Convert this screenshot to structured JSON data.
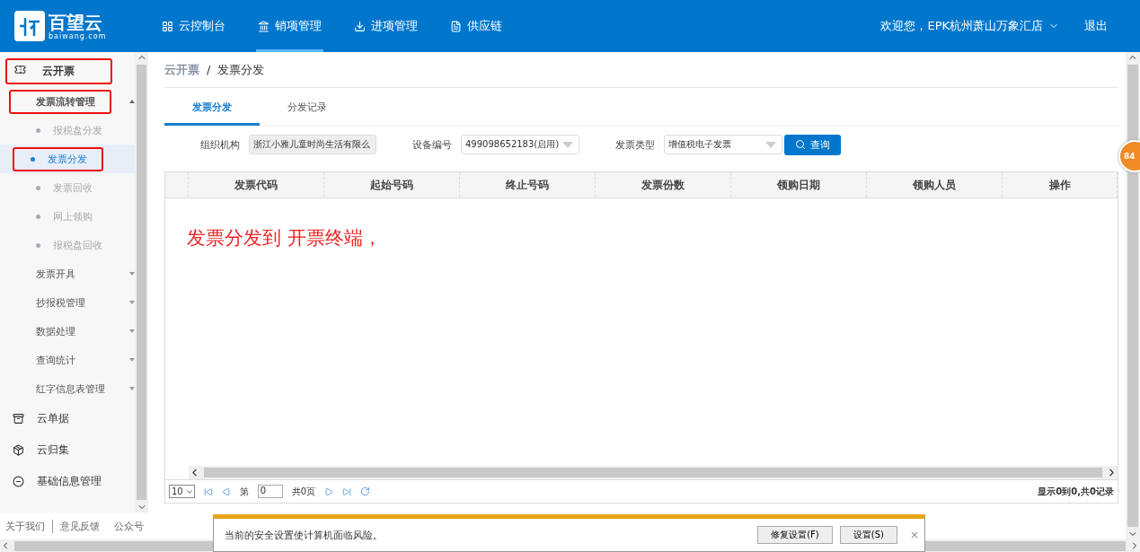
{
  "header": {
    "logo": {
      "name": "百望云",
      "domain": "baiwang.com"
    },
    "nav": [
      {
        "label": "云控制台",
        "selected": false
      },
      {
        "label": "销项管理",
        "selected": true
      },
      {
        "label": "进项管理",
        "selected": false
      },
      {
        "label": "供应链",
        "selected": false
      }
    ],
    "user": "欢迎您，EPK杭州萧山万象汇店",
    "logout": "退出"
  },
  "sidebar": {
    "items": [
      {
        "label": "云开票",
        "expanded": true,
        "annotated": true,
        "children": [
          {
            "label": "发票流转管理",
            "expanded": true,
            "annotated": true,
            "children": [
              {
                "label": "报税盘分发",
                "selected": false,
                "annotated": false
              },
              {
                "label": "发票分发",
                "selected": true,
                "annotated": true
              },
              {
                "label": "发票回收",
                "selected": false,
                "annotated": false
              },
              {
                "label": "网上领购",
                "selected": false,
                "annotated": false
              },
              {
                "label": "报税盘回收",
                "selected": false,
                "annotated": false
              }
            ]
          },
          {
            "label": "发票开具",
            "expanded": false,
            "annotated": false
          },
          {
            "label": "抄报税管理",
            "expanded": false,
            "annotated": false
          },
          {
            "label": "数据处理",
            "expanded": false,
            "annotated": false
          },
          {
            "label": "查询统计",
            "expanded": false,
            "annotated": false
          },
          {
            "label": "红字信息表管理",
            "expanded": false,
            "annotated": false
          }
        ]
      },
      {
        "label": "云单据",
        "expanded": false,
        "annotated": false
      },
      {
        "label": "云归集",
        "expanded": false,
        "annotated": false
      },
      {
        "label": "基础信息管理",
        "expanded": false,
        "annotated": false
      }
    ]
  },
  "footer_links": [
    "关于我们",
    "意见反馈",
    "公众号"
  ],
  "breadcrumb": {
    "items": [
      "云开票",
      "发票分发"
    ],
    "separator": "/"
  },
  "tabs": [
    {
      "label": "发票分发",
      "selected": true
    },
    {
      "label": "分发记录",
      "selected": false
    }
  ],
  "filters": [
    {
      "label": "组织机构",
      "value": "浙江小雅儿童时尚生活有限么",
      "kind": "readonly"
    },
    {
      "label": "设备编号",
      "value": "499098652183(启用)",
      "kind": "select"
    },
    {
      "label": "发票类型",
      "value": "增值税电子发票",
      "kind": "select"
    }
  ],
  "query_button": "查询",
  "table": {
    "columns": [
      "发票代码",
      "起始号码",
      "终止号码",
      "发票份数",
      "领购日期",
      "领购人员",
      "操作"
    ]
  },
  "annotation": "发票分发到 开票终端，",
  "pager": {
    "page_size": "10",
    "page_label": "第",
    "page": "0",
    "total_pages": "共0页",
    "summary": "显示0到0,共0记录"
  },
  "badge": "84",
  "security_bar": {
    "message": "当前的安全设置使计算机面临风险。",
    "buttons": [
      "修复设置(F)",
      "设置(S)"
    ],
    "close": "×"
  }
}
